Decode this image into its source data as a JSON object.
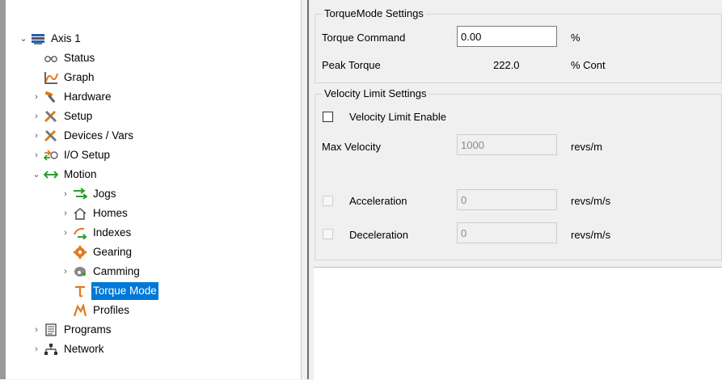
{
  "tree": {
    "items": [
      {
        "label": "Axis 1",
        "chevron": "⌄",
        "icon": "monitor-icon"
      },
      {
        "label": "Status",
        "chevron": "",
        "icon": "glasses-icon"
      },
      {
        "label": "Graph",
        "chevron": "",
        "icon": "graph-icon"
      },
      {
        "label": "Hardware",
        "chevron": "›",
        "icon": "hammer-icon"
      },
      {
        "label": "Setup",
        "chevron": "›",
        "icon": "tools-icon"
      },
      {
        "label": "Devices / Vars",
        "chevron": "›",
        "icon": "tools-icon"
      },
      {
        "label": "I/O Setup",
        "chevron": "›",
        "icon": "io-icon"
      },
      {
        "label": "Motion",
        "chevron": "⌄",
        "icon": "double-arrow-icon"
      },
      {
        "label": "Jogs",
        "chevron": "›",
        "icon": "jog-arrows-icon"
      },
      {
        "label": "Homes",
        "chevron": "›",
        "icon": "home-icon"
      },
      {
        "label": "Indexes",
        "chevron": "›",
        "icon": "index-icon"
      },
      {
        "label": "Gearing",
        "chevron": "",
        "icon": "gear-icon"
      },
      {
        "label": "Camming",
        "chevron": "›",
        "icon": "cam-icon"
      },
      {
        "label": "Torque Mode",
        "chevron": "",
        "icon": "tau-icon"
      },
      {
        "label": "Profiles",
        "chevron": "",
        "icon": "profile-icon"
      },
      {
        "label": "Programs",
        "chevron": "›",
        "icon": "document-icon"
      },
      {
        "label": "Network",
        "chevron": "›",
        "icon": "network-icon"
      }
    ]
  },
  "torque": {
    "title": "TorqueMode Settings",
    "command_label": "Torque Command",
    "command_value": "0.00",
    "command_unit": "%",
    "peak_label": "Peak Torque",
    "peak_value": "222.0",
    "peak_unit": "% Cont"
  },
  "velocity": {
    "title": "Velocity Limit Settings",
    "enable_label": "Velocity Limit Enable",
    "max_label": "Max Velocity",
    "max_value": "1000",
    "max_unit": "revs/m",
    "accel_label": "Acceleration",
    "accel_value": "0",
    "accel_unit": "revs/m/s",
    "decel_label": "Deceleration",
    "decel_value": "0",
    "decel_unit": "revs/m/s"
  },
  "colors": {
    "selection": "#0078d7",
    "orange": "#e07a1c",
    "green": "#2e9e2e"
  }
}
